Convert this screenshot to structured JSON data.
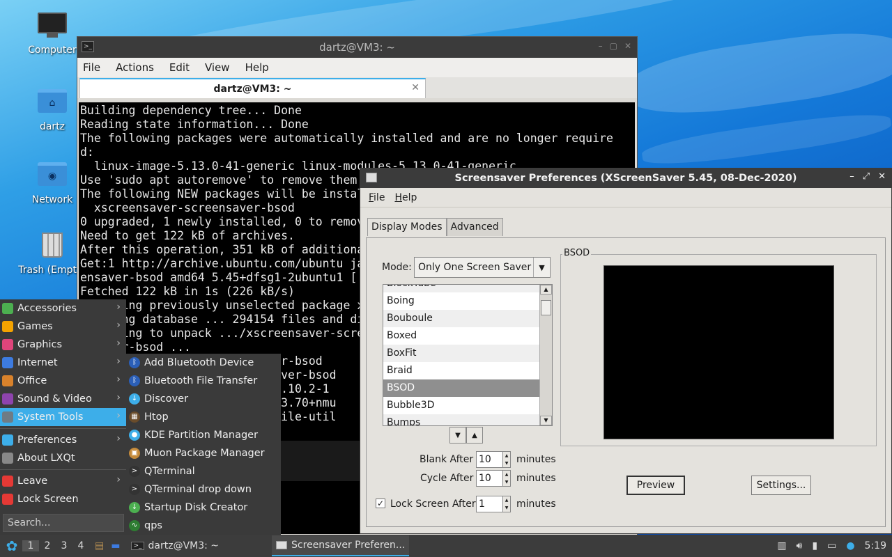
{
  "desktop": {
    "icons": [
      {
        "label": "Computer",
        "icon": "computer-icon"
      },
      {
        "label": "dartz",
        "icon": "home-folder-icon"
      },
      {
        "label": "Network",
        "icon": "network-folder-icon"
      },
      {
        "label": "Trash (Empty)",
        "icon": "trash-icon"
      }
    ]
  },
  "terminal": {
    "window_title": "dartz@VM3: ~",
    "menu": [
      "File",
      "Actions",
      "Edit",
      "View",
      "Help"
    ],
    "tab_title": "dartz@VM3: ~",
    "lines": [
      "Building dependency tree... Done",
      "Reading state information... Done",
      "The following packages were automatically installed and are no longer require",
      "d:",
      "  linux-image-5.13.0-41-generic linux-modules-5.13.0-41-generic",
      "Use 'sudo apt autoremove' to remove them.",
      "The following NEW packages will be installed:",
      "  xscreensaver-screensaver-bsod",
      "0 upgraded, 1 newly installed, 0 to remove",
      "Need to get 122 kB of archives.",
      "After this operation, 351 kB of additional",
      "Get:1 http://archive.ubuntu.com/ubuntu ja",
      "ensaver-bsod amd64 5.45+dfsg1-2ubuntu1 [",
      "Fetched 122 kB in 1s (226 kB/s)",
      "Selecting previously unselected package x",
      "(Reading database ... 294154 files and di",
      "Preparing to unpack .../xscreensaver-scre",
      "ensaver-bsod ...",
      "                         saver-bsod",
      "                         ensaver-bsod",
      "                         b (2.10.2-1",
      "                         ap (3.70+nmu",
      "                         op-file-util"
    ]
  },
  "screensaver": {
    "window_title": "Screensaver Preferences  (XScreenSaver 5.45, 08-Dec-2020)",
    "menu": [
      "File",
      "Help"
    ],
    "tabs": [
      "Display Modes",
      "Advanced"
    ],
    "mode_label": "Mode:",
    "mode_value": "Only One Screen Saver",
    "list": [
      "BlockTube",
      "Boing",
      "Bouboule",
      "Boxed",
      "BoxFit",
      "Braid",
      "BSOD",
      "Bubble3D",
      "Bumps"
    ],
    "selected": "BSOD",
    "preview_frame_label": "BSOD",
    "blank_after_label": "Blank After",
    "blank_after_value": "10",
    "cycle_after_label": "Cycle After",
    "cycle_after_value": "10",
    "lock_label": "Lock Screen After",
    "lock_value": "1",
    "lock_checked": true,
    "minutes": "minutes",
    "preview_button": "Preview",
    "settings_button": "Settings..."
  },
  "start_menu": {
    "items": [
      {
        "label": "Accessories",
        "color": "#4caf50",
        "arrow": true
      },
      {
        "label": "Games",
        "color": "#f4a300",
        "arrow": true
      },
      {
        "label": "Graphics",
        "color": "#e0457b",
        "arrow": true
      },
      {
        "label": "Internet",
        "color": "#3d7be0",
        "arrow": true
      },
      {
        "label": "Office",
        "color": "#d9822b",
        "arrow": true
      },
      {
        "label": "Sound & Video",
        "color": "#8e44ad",
        "arrow": true
      },
      {
        "label": "System Tools",
        "color": "#6f7c85",
        "arrow": true,
        "active": true
      },
      {
        "label": "Preferences",
        "color": "#3daee9",
        "arrow": true
      },
      {
        "label": "About LXQt",
        "color": "#888888",
        "arrow": false
      },
      {
        "label": "Leave",
        "color": "#e53935",
        "arrow": true
      },
      {
        "label": "Lock Screen",
        "color": "#e53935",
        "arrow": false
      }
    ],
    "search_placeholder": "Search...",
    "submenu": [
      {
        "label": "Add Bluetooth Device",
        "color": "#2b5fb8",
        "glyph": "ᛒ"
      },
      {
        "label": "Bluetooth File Transfer",
        "color": "#2b5fb8",
        "glyph": "ᛒ"
      },
      {
        "label": "Discover",
        "color": "#3daee9",
        "glyph": "↓"
      },
      {
        "label": "Htop",
        "color": "#6a4c2a",
        "glyph": "▦"
      },
      {
        "label": "KDE Partition Manager",
        "color": "#3daee9",
        "glyph": "●"
      },
      {
        "label": "Muon Package Manager",
        "color": "#c48a3a",
        "glyph": "▣"
      },
      {
        "label": "QTerminal",
        "color": "#333333",
        "glyph": ">"
      },
      {
        "label": "QTerminal drop down",
        "color": "#333333",
        "glyph": ">"
      },
      {
        "label": "Startup Disk Creator",
        "color": "#4caf50",
        "glyph": "↓"
      },
      {
        "label": "qps",
        "color": "#2e7d32",
        "glyph": "∿"
      }
    ]
  },
  "taskbar": {
    "desktops": [
      "1",
      "2",
      "3",
      "4"
    ],
    "tasks": [
      "dartz@VM3: ~",
      "Screensaver Preferen..."
    ],
    "clock": "5:19"
  }
}
